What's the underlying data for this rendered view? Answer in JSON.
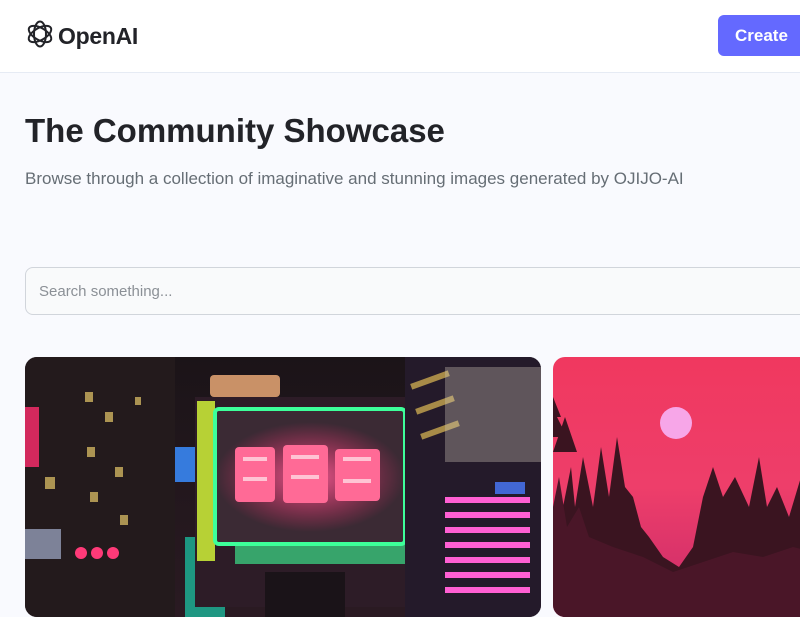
{
  "header": {
    "brand": "OpenAI",
    "brand_icon": "openai-logo-icon",
    "create_label": "Create",
    "accent_color": "#6469ff"
  },
  "main": {
    "title": "The Community Showcase",
    "subtitle": "Browse through a collection of imaginative and stunning images generated by OJIJO-AI"
  },
  "search": {
    "placeholder": "Search something...",
    "value": ""
  },
  "gallery": {
    "cards": [
      {
        "image": "neon-city-street-night"
      },
      {
        "image": "pink-sunset-forest-silhouette"
      }
    ]
  }
}
